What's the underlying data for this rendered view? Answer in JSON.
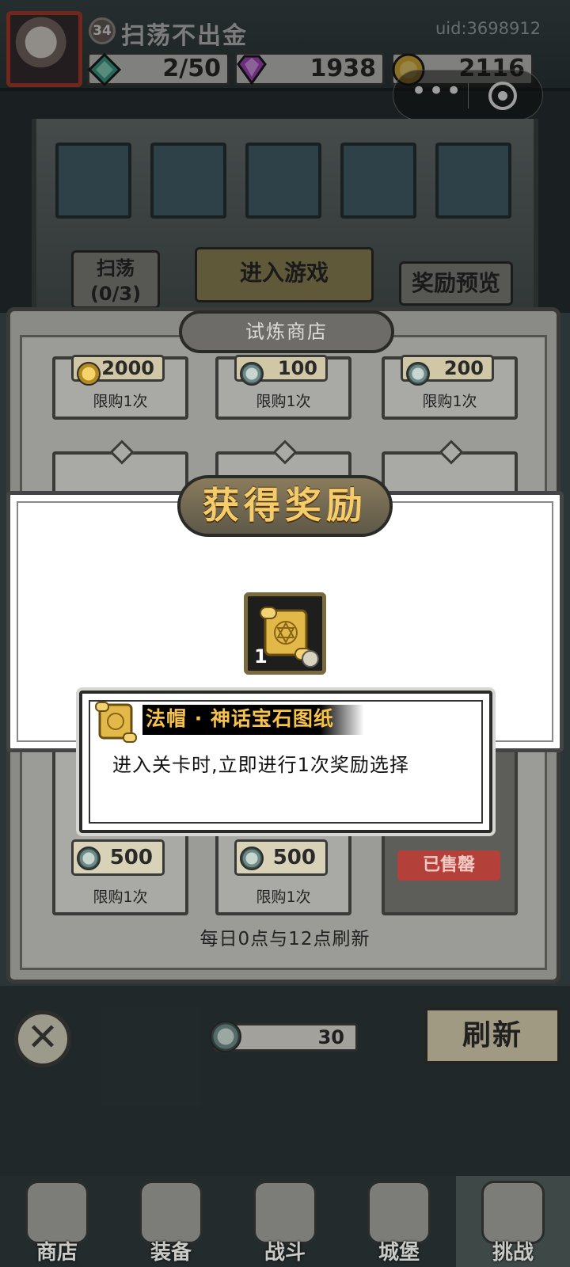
{
  "player": {
    "level": "34",
    "name": "扫荡不出金",
    "uid": "uid:3698912"
  },
  "resources": {
    "energy": "2/50",
    "gems": "1938",
    "gold": "2116"
  },
  "stage": {
    "sweep_label": "扫荡",
    "sweep_count": "(0/3)",
    "enter_label": "进入游戏",
    "preview_label": "奖励预览"
  },
  "shop": {
    "title": "试炼商店",
    "top_row": [
      {
        "price": "2000",
        "limit": "限购1次"
      },
      {
        "price": "100",
        "limit": "限购1次"
      },
      {
        "price": "200",
        "limit": "限购1次"
      }
    ],
    "bottom_row": [
      {
        "price": "500",
        "limit": "限购1次"
      },
      {
        "price": "500",
        "limit": "限购1次"
      },
      {
        "sold": "已售罄"
      }
    ],
    "refresh_note": "每日0点与12点刷新",
    "currency_amount": "30",
    "refresh_button": "刷新"
  },
  "reward": {
    "title": "获得奖励",
    "item_count": "1",
    "item_name": "法帽 · 神话宝石图纸",
    "item_desc": "进入关卡时,立即进行1次奖励选择"
  },
  "tabs": [
    {
      "label": "商店"
    },
    {
      "label": "装备"
    },
    {
      "label": "战斗"
    },
    {
      "label": "城堡"
    },
    {
      "label": "挑战"
    }
  ],
  "colors": {
    "title_gold": "#f6cc6a",
    "sold_red": "#b3413a",
    "panel_grey": "#8a8a86"
  }
}
